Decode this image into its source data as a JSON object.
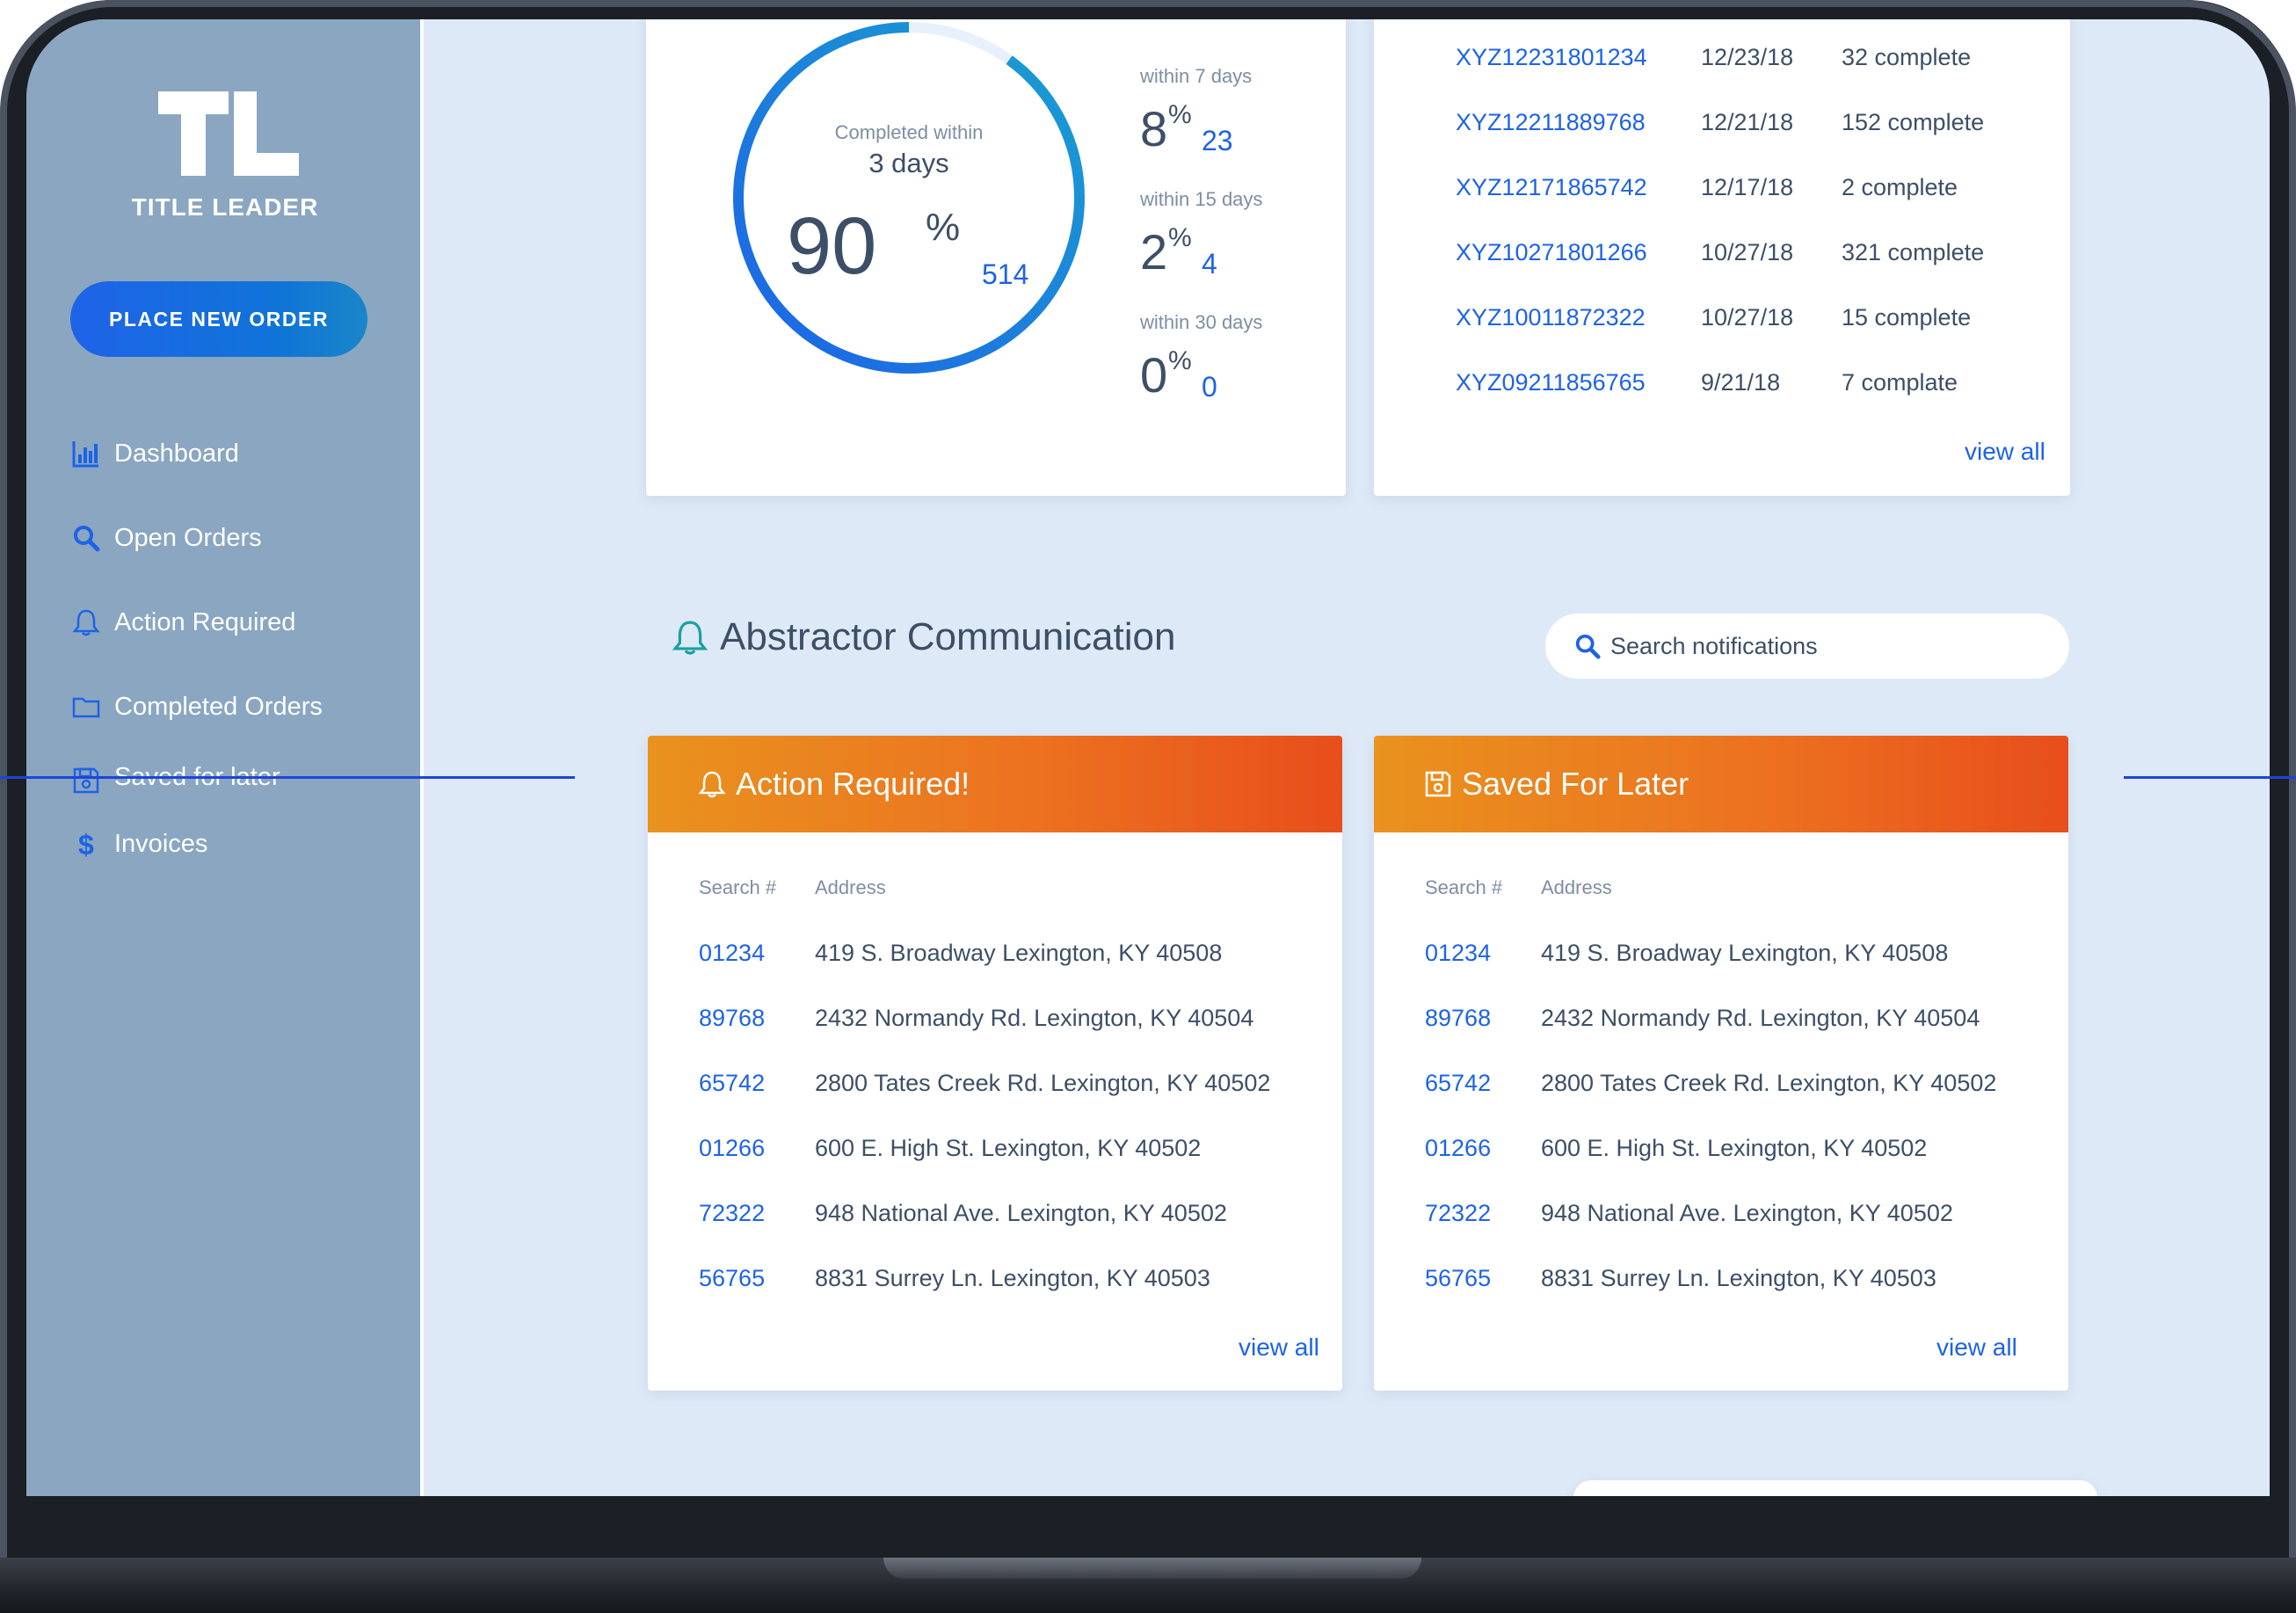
{
  "brand": {
    "logo_text": "TITLE LEADER",
    "accent": "#1d63e6",
    "sidebar_bg": "#8aa6c1",
    "header_orange": "#ec7220"
  },
  "sidebar": {
    "cta_label": "PLACE NEW ORDER",
    "items": [
      {
        "label": "Dashboard",
        "icon": "bar-chart-icon"
      },
      {
        "label": "Open Orders",
        "icon": "search-icon"
      },
      {
        "label": "Action Required",
        "icon": "bell-icon"
      },
      {
        "label": "Completed Orders",
        "icon": "folder-icon"
      },
      {
        "label": "Saved for later",
        "icon": "floppy-disk-icon"
      },
      {
        "label": "Invoices",
        "icon": "dollar-icon"
      }
    ]
  },
  "completion": {
    "ring_caption": "Completed within",
    "ring_days": "3 days",
    "ring_value": "90",
    "ring_unit": "%",
    "ring_count": "514",
    "ring_fraction": 0.9,
    "stats": [
      {
        "label": "within 7 days",
        "value": "8",
        "unit": "%",
        "count": "23"
      },
      {
        "label": "within 15 days",
        "value": "2",
        "unit": "%",
        "count": "4"
      },
      {
        "label": "within 30 days",
        "value": "0",
        "unit": "%",
        "count": "0"
      }
    ]
  },
  "orders": {
    "rows": [
      {
        "id": "XYZ12231801234",
        "date": "12/23/18",
        "status": "32 complete"
      },
      {
        "id": "XYZ12211889768",
        "date": "12/21/18",
        "status": "152 complete"
      },
      {
        "id": "XYZ12171865742",
        "date": "12/17/18",
        "status": "2 complete"
      },
      {
        "id": "XYZ10271801266",
        "date": "10/27/18",
        "status": "321 complete"
      },
      {
        "id": "XYZ10011872322",
        "date": "10/27/18",
        "status": "15 complete"
      },
      {
        "id": "XYZ09211856765",
        "date": "9/21/18",
        "status": "7 complate"
      }
    ],
    "view_all": "view all"
  },
  "communication": {
    "title": "Abstractor Communication",
    "search_placeholder": "Search notifications",
    "col_search": "Search #",
    "col_address": "Address",
    "view_all": "view all",
    "action_required": {
      "title": "Action Required!",
      "rows": [
        {
          "search": "01234",
          "address": "419 S. Broadway Lexington, KY 40508"
        },
        {
          "search": "89768",
          "address": "2432 Normandy Rd. Lexington, KY 40504"
        },
        {
          "search": "65742",
          "address": "2800 Tates Creek Rd. Lexington, KY 40502"
        },
        {
          "search": "01266",
          "address": "600 E. High St. Lexington, KY 40502"
        },
        {
          "search": "72322",
          "address": "948 National Ave. Lexington, KY 40502"
        },
        {
          "search": "56765",
          "address": "8831 Surrey Ln. Lexington, KY 40503"
        }
      ]
    },
    "saved_for_later": {
      "title": "Saved For Later",
      "rows": [
        {
          "search": "01234",
          "address": "419 S. Broadway Lexington, KY 40508"
        },
        {
          "search": "89768",
          "address": "2432 Normandy Rd. Lexington, KY 40504"
        },
        {
          "search": "65742",
          "address": "2800 Tates Creek Rd. Lexington, KY 40502"
        },
        {
          "search": "01266",
          "address": "600 E. High St. Lexington, KY 40502"
        },
        {
          "search": "72322",
          "address": "948 National Ave. Lexington, KY 40502"
        },
        {
          "search": "56765",
          "address": "8831 Surrey Ln. Lexington, KY 40503"
        }
      ]
    }
  }
}
